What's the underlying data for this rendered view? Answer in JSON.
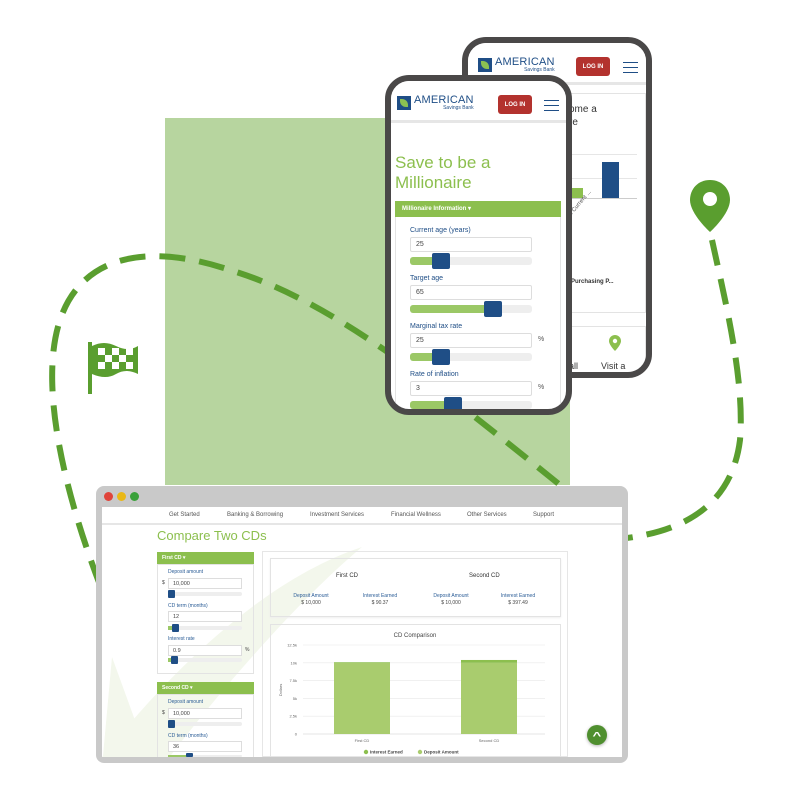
{
  "colors": {
    "brand_green": "#8cbf4e",
    "path_green": "#5a9e2f",
    "navy": "#1f4e86",
    "login_red": "#b3322e"
  },
  "icons": {
    "flag": "checkered-flag-icon",
    "pin": "map-pin-icon",
    "scroll_top": "chevron-up-icon"
  },
  "back_phone": {
    "logo": {
      "name": "AMERICAN",
      "sub": "Savings Bank"
    },
    "login": "LOG IN",
    "title_fragment_1": "ome a",
    "title_fragment_2": "re",
    "chart_label": "llion in Current ...",
    "chart_label_2": "g",
    "legend_fragment": "Purchasing P...",
    "bottom_fragment_1": "all",
    "bottom_fragment_2": "Visit a"
  },
  "front_phone": {
    "logo": {
      "name": "AMERICAN",
      "sub": "Savings Bank"
    },
    "login": "LOG IN",
    "title_line1": "Save to be a",
    "title_line2": "Millionaire",
    "section": "Millionaire Information ▾",
    "fields": [
      {
        "label": "Current age (years)",
        "value": "25",
        "unit": "",
        "fill": 0.25
      },
      {
        "label": "Target age",
        "value": "65",
        "unit": "",
        "fill": 0.68
      },
      {
        "label": "Marginal tax rate",
        "value": "25",
        "unit": "%",
        "fill": 0.25
      },
      {
        "label": "Rate of inflation",
        "value": "3",
        "unit": "%",
        "fill": 0.35
      }
    ]
  },
  "desktop": {
    "nav": [
      "Get Started",
      "Banking & Borrowing",
      "Investment Services",
      "Financial Wellness",
      "Other Services",
      "Support"
    ],
    "title": "Compare Two CDs",
    "first_cd": {
      "header": "First CD ▾",
      "deposit_label": "Deposit amount",
      "deposit_prefix": "$",
      "deposit": "10,000",
      "term_label": "CD term (months)",
      "term": "12",
      "rate_label": "Interest rate",
      "rate": "0.9",
      "rate_unit": "%"
    },
    "second_cd": {
      "header": "Second CD ▾",
      "deposit_label": "Deposit amount",
      "deposit_prefix": "$",
      "deposit": "10,000",
      "term_label": "CD term (months)",
      "term": "36"
    },
    "summary": {
      "first_title": "First CD",
      "second_title": "Second CD",
      "cols": [
        {
          "label": "Deposit Amount",
          "value": "$ 10,000"
        },
        {
          "label": "Interest Earned",
          "value": "$ 90.37"
        },
        {
          "label": "Deposit Amount",
          "value": "$ 10,000"
        },
        {
          "label": "Interest Earned",
          "value": "$ 397.49"
        }
      ]
    }
  },
  "chart_data": {
    "type": "bar",
    "stacked": true,
    "title": "CD Comparison",
    "ylabel": "Dollars",
    "categories": [
      "First CD",
      "Second CD"
    ],
    "yticks": [
      "0",
      "2.5k",
      "5k",
      "7.5k",
      "10k",
      "12.5k"
    ],
    "ylim": [
      0,
      12500
    ],
    "grid": true,
    "legend_position": "bottom",
    "series": [
      {
        "name": "Interest Earned",
        "values": [
          90.37,
          397.49
        ],
        "color": "#8cbf4e"
      },
      {
        "name": "Deposit Amount",
        "values": [
          10000,
          10000
        ],
        "color": "#a9cc6e"
      }
    ]
  }
}
